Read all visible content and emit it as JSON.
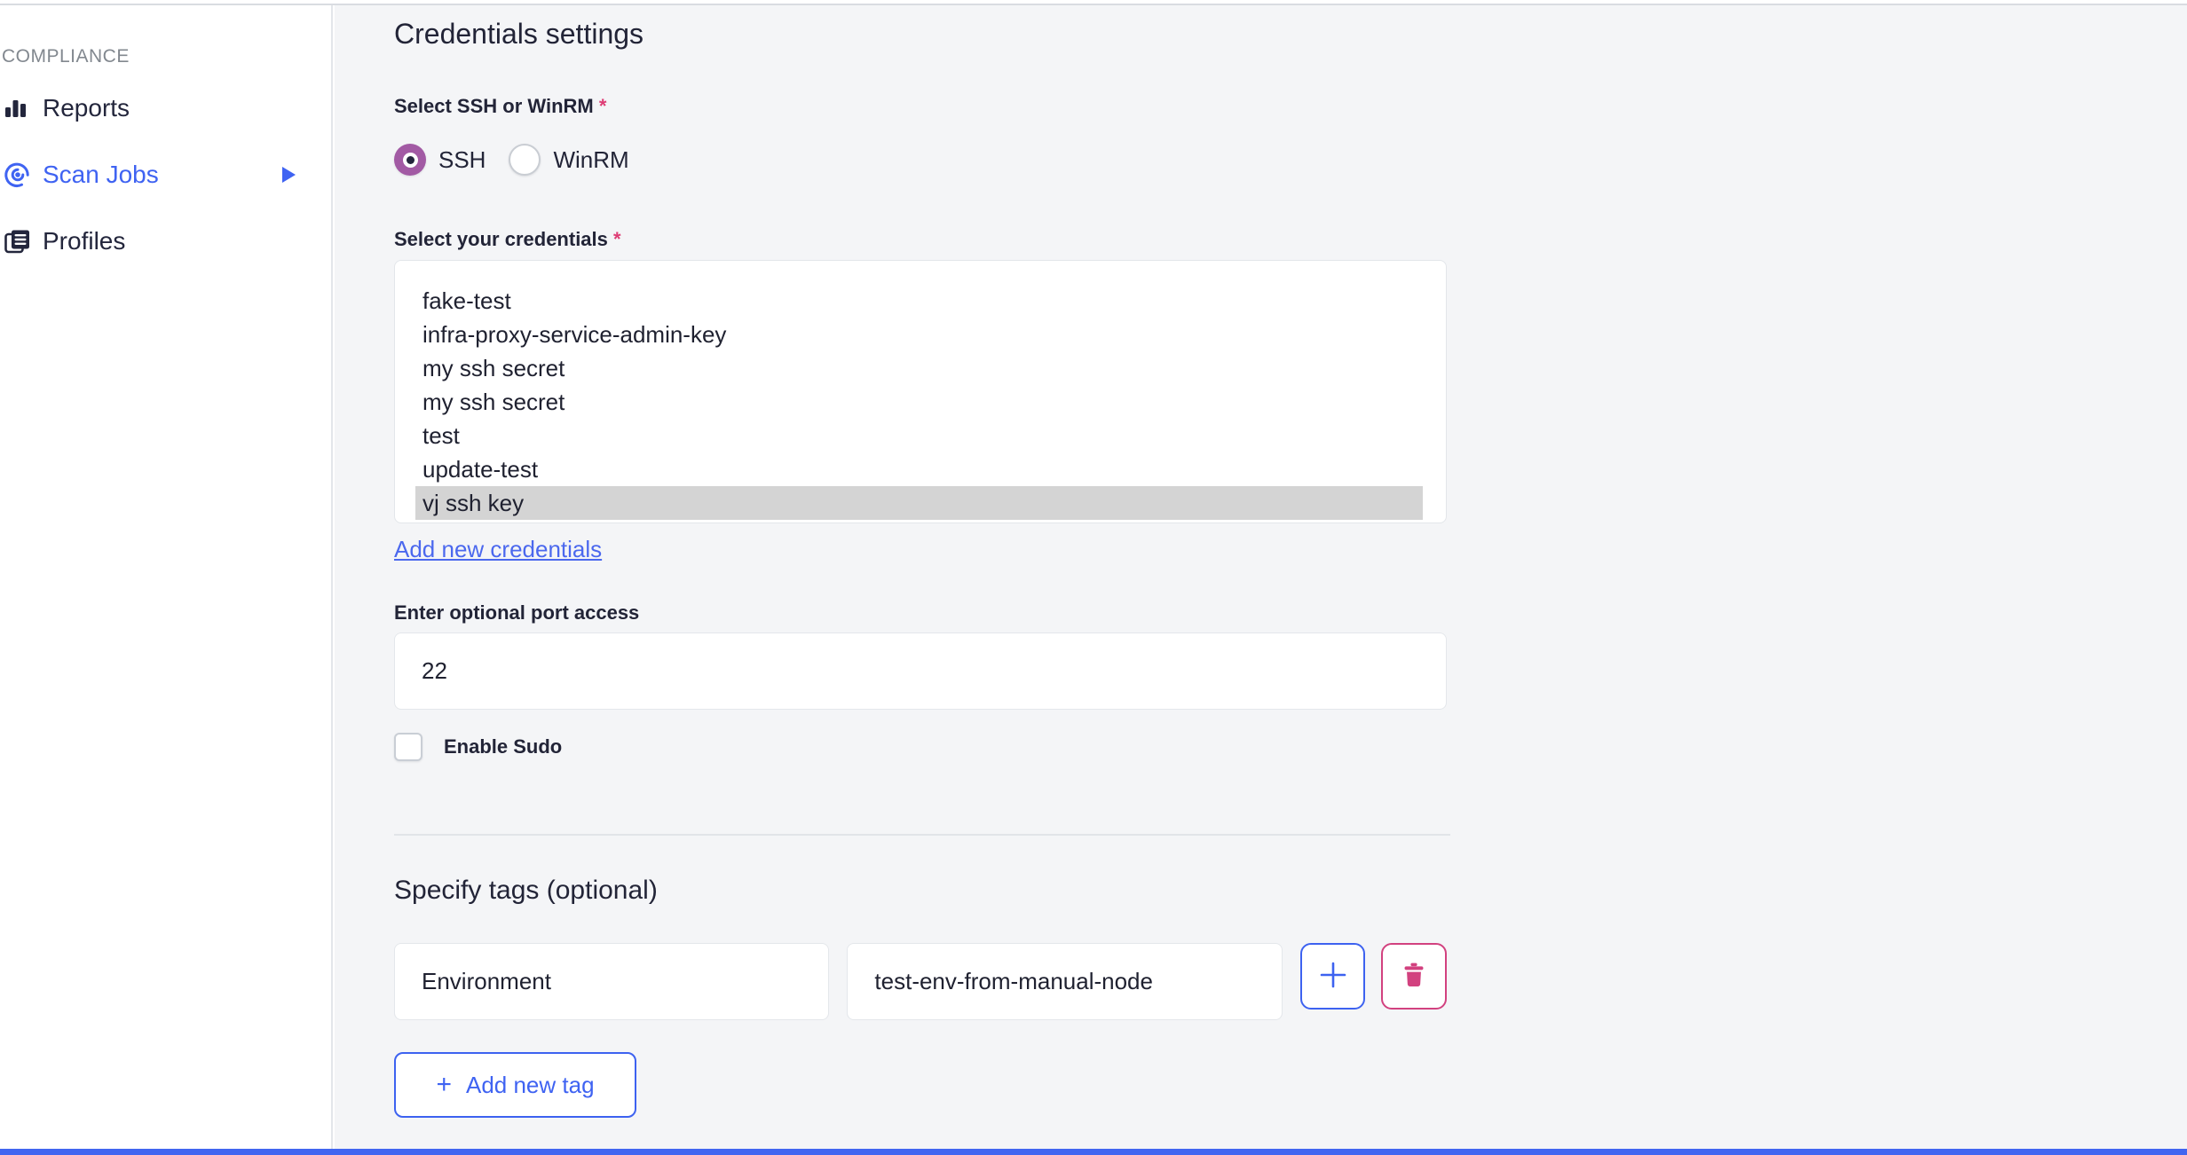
{
  "ui": {
    "required_marker": "*"
  },
  "sidebar": {
    "section_label": "COMPLIANCE",
    "items": [
      {
        "label": "Reports",
        "icon": "reports-bar-chart-icon",
        "active": false,
        "has_submenu": false
      },
      {
        "label": "Scan Jobs",
        "icon": "scan-jobs-broadcast-icon",
        "active": true,
        "has_submenu": true
      },
      {
        "label": "Profiles",
        "icon": "profiles-documents-icon",
        "active": false,
        "has_submenu": false
      }
    ]
  },
  "main": {
    "title": "Credentials settings",
    "protocol_field": {
      "label": "Select SSH or WinRM",
      "required": true,
      "options": [
        "SSH",
        "WinRM"
      ],
      "selected": "SSH"
    },
    "credentials_field": {
      "label": "Select your credentials",
      "required": true,
      "options": [
        "fake-test",
        "infra-proxy-service-admin-key",
        "my ssh secret",
        "my ssh secret",
        "test",
        "update-test",
        "vj ssh key"
      ],
      "selected": "vj ssh key",
      "add_link_label": "Add new credentials"
    },
    "port_field": {
      "label": "Enter optional port access",
      "value": "22"
    },
    "sudo_checkbox": {
      "label": "Enable Sudo",
      "checked": false
    },
    "tags_section": {
      "title": "Specify tags (optional)",
      "rows": [
        {
          "key": "Environment",
          "value": "test-env-from-manual-node"
        }
      ],
      "add_button_label": "Add new tag",
      "plus_symbol": "+"
    }
  },
  "colors": {
    "accent_blue": "#3f63f2",
    "link_blue": "#4b68ee",
    "radio_selected_purple": "#a25aa4",
    "delete_pink": "#d2417f",
    "required_pink": "#de3c74",
    "selected_option_gray": "#d4d4d4",
    "background_gray": "#f4f5f7",
    "bottom_bar_blue": "#4165f0",
    "text_navy": "#222437"
  }
}
